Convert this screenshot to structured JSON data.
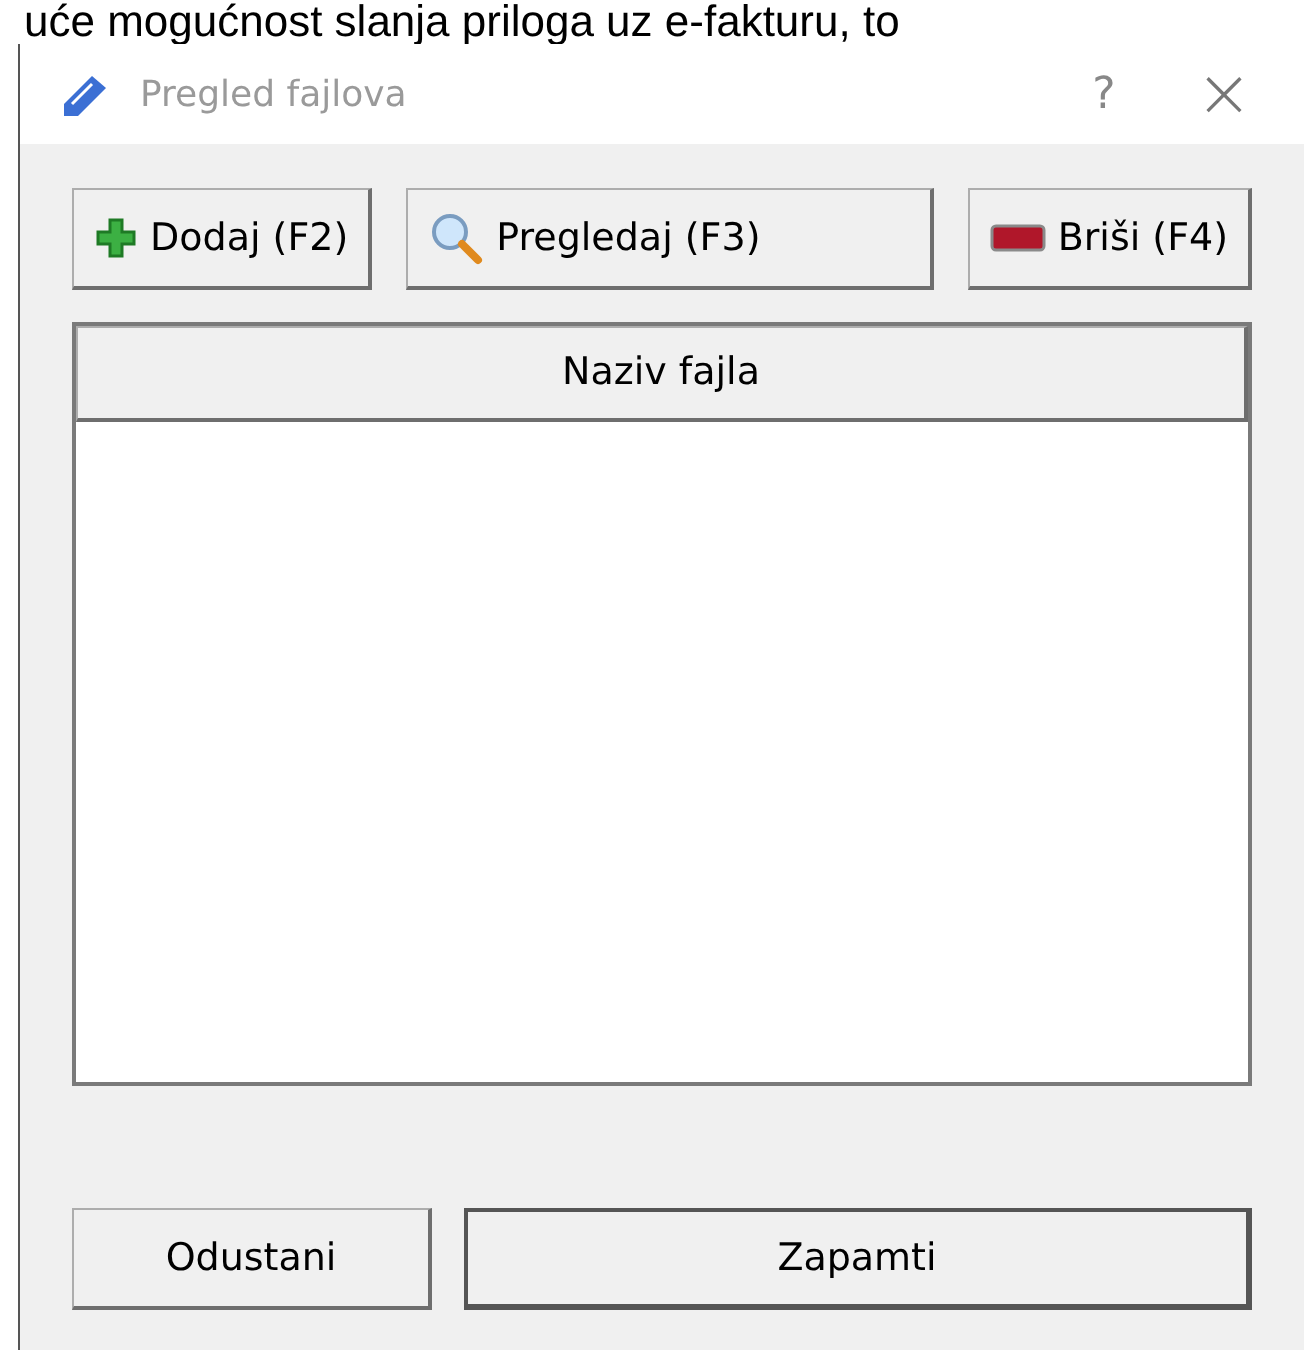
{
  "background_text": "uće mogućnost slanja priloga uz e-fakturu, to",
  "window": {
    "title": "Pregled fajlova",
    "help": "?",
    "close": "×"
  },
  "toolbar": [
    {
      "kind": "add",
      "label": "Dodaj (F2)"
    },
    {
      "kind": "view",
      "label": "Pregledaj (F3)"
    },
    {
      "kind": "delete",
      "label": "Briši (F4)"
    }
  ],
  "table": {
    "columns": [
      "Naziv fajla"
    ]
  },
  "buttons": [
    {
      "label": "Odustani",
      "default": false
    },
    {
      "label": "Zapamti",
      "default": true
    }
  ]
}
